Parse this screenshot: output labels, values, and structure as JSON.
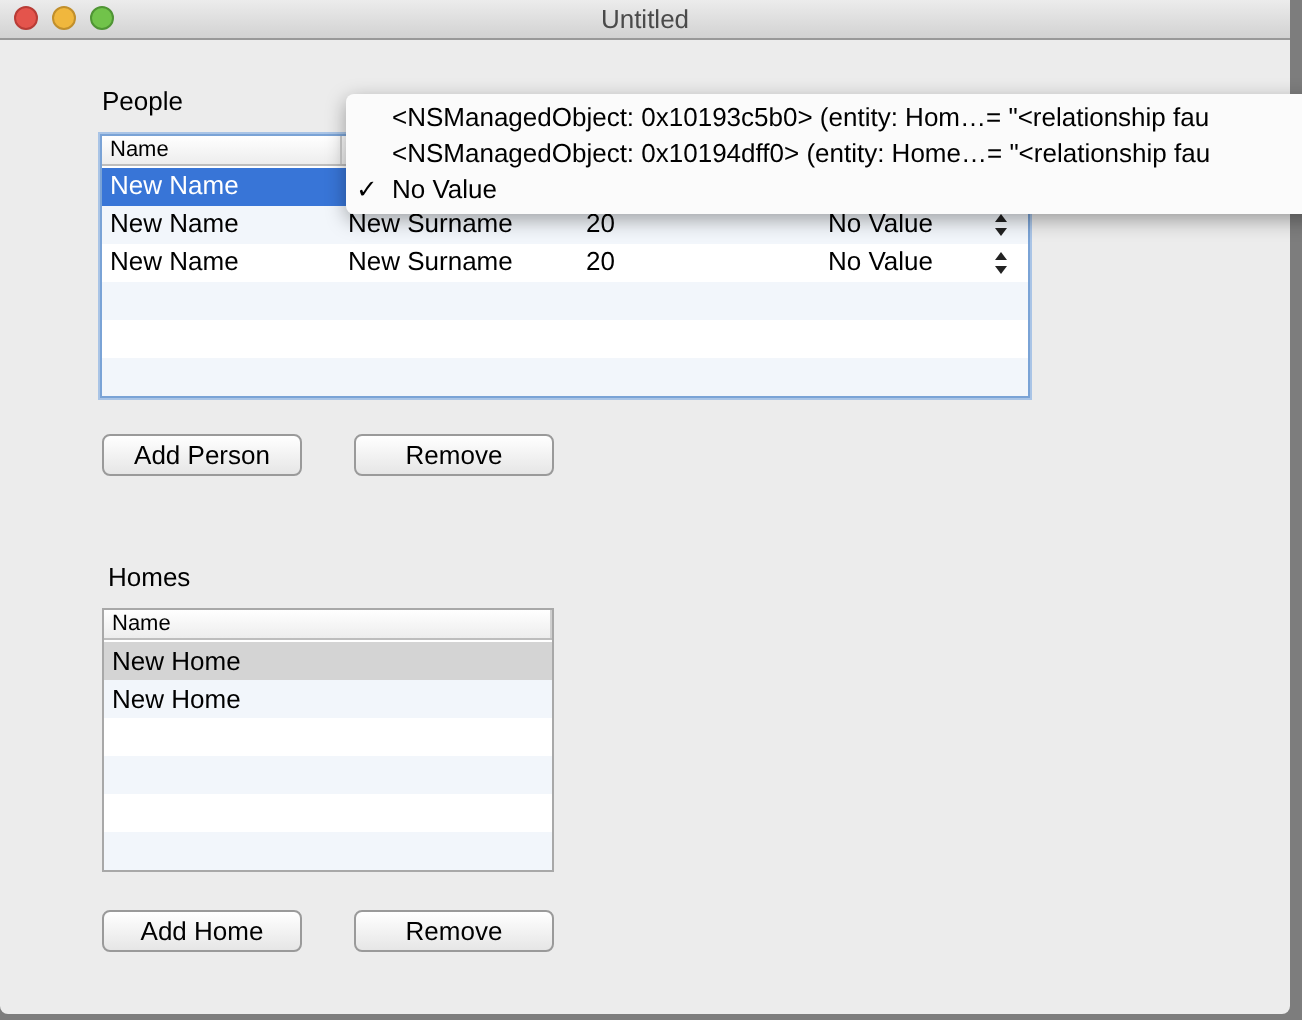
{
  "window": {
    "title": "Untitled"
  },
  "people": {
    "label": "People",
    "columns": [
      "Name"
    ],
    "rows": [
      {
        "selected": true,
        "cells": [
          "New Name"
        ]
      },
      {
        "selected": false,
        "cells": [
          "New Name",
          "New Surname",
          "20",
          "No Value"
        ]
      },
      {
        "selected": false,
        "cells": [
          "New Name",
          "New Surname",
          "20",
          "No Value"
        ]
      }
    ],
    "buttons": [
      "Add Person",
      "Remove"
    ]
  },
  "popup_menu": {
    "items": [
      {
        "label": "<NSManagedObject: 0x10193c5b0> (entity: Hom…= \"<relationship fau",
        "checked": false
      },
      {
        "label": "<NSManagedObject: 0x10194dff0> (entity: Home…= \"<relationship fau",
        "checked": false
      },
      {
        "label": "No Value",
        "checked": true
      }
    ],
    "check": "✓"
  },
  "homes": {
    "label": "Homes",
    "columns": [
      "Name"
    ],
    "rows": [
      {
        "selected": true,
        "cells": [
          "New Home"
        ]
      },
      {
        "selected": false,
        "cells": [
          "New Home"
        ]
      }
    ],
    "buttons": [
      "Add Home",
      "Remove"
    ]
  }
}
